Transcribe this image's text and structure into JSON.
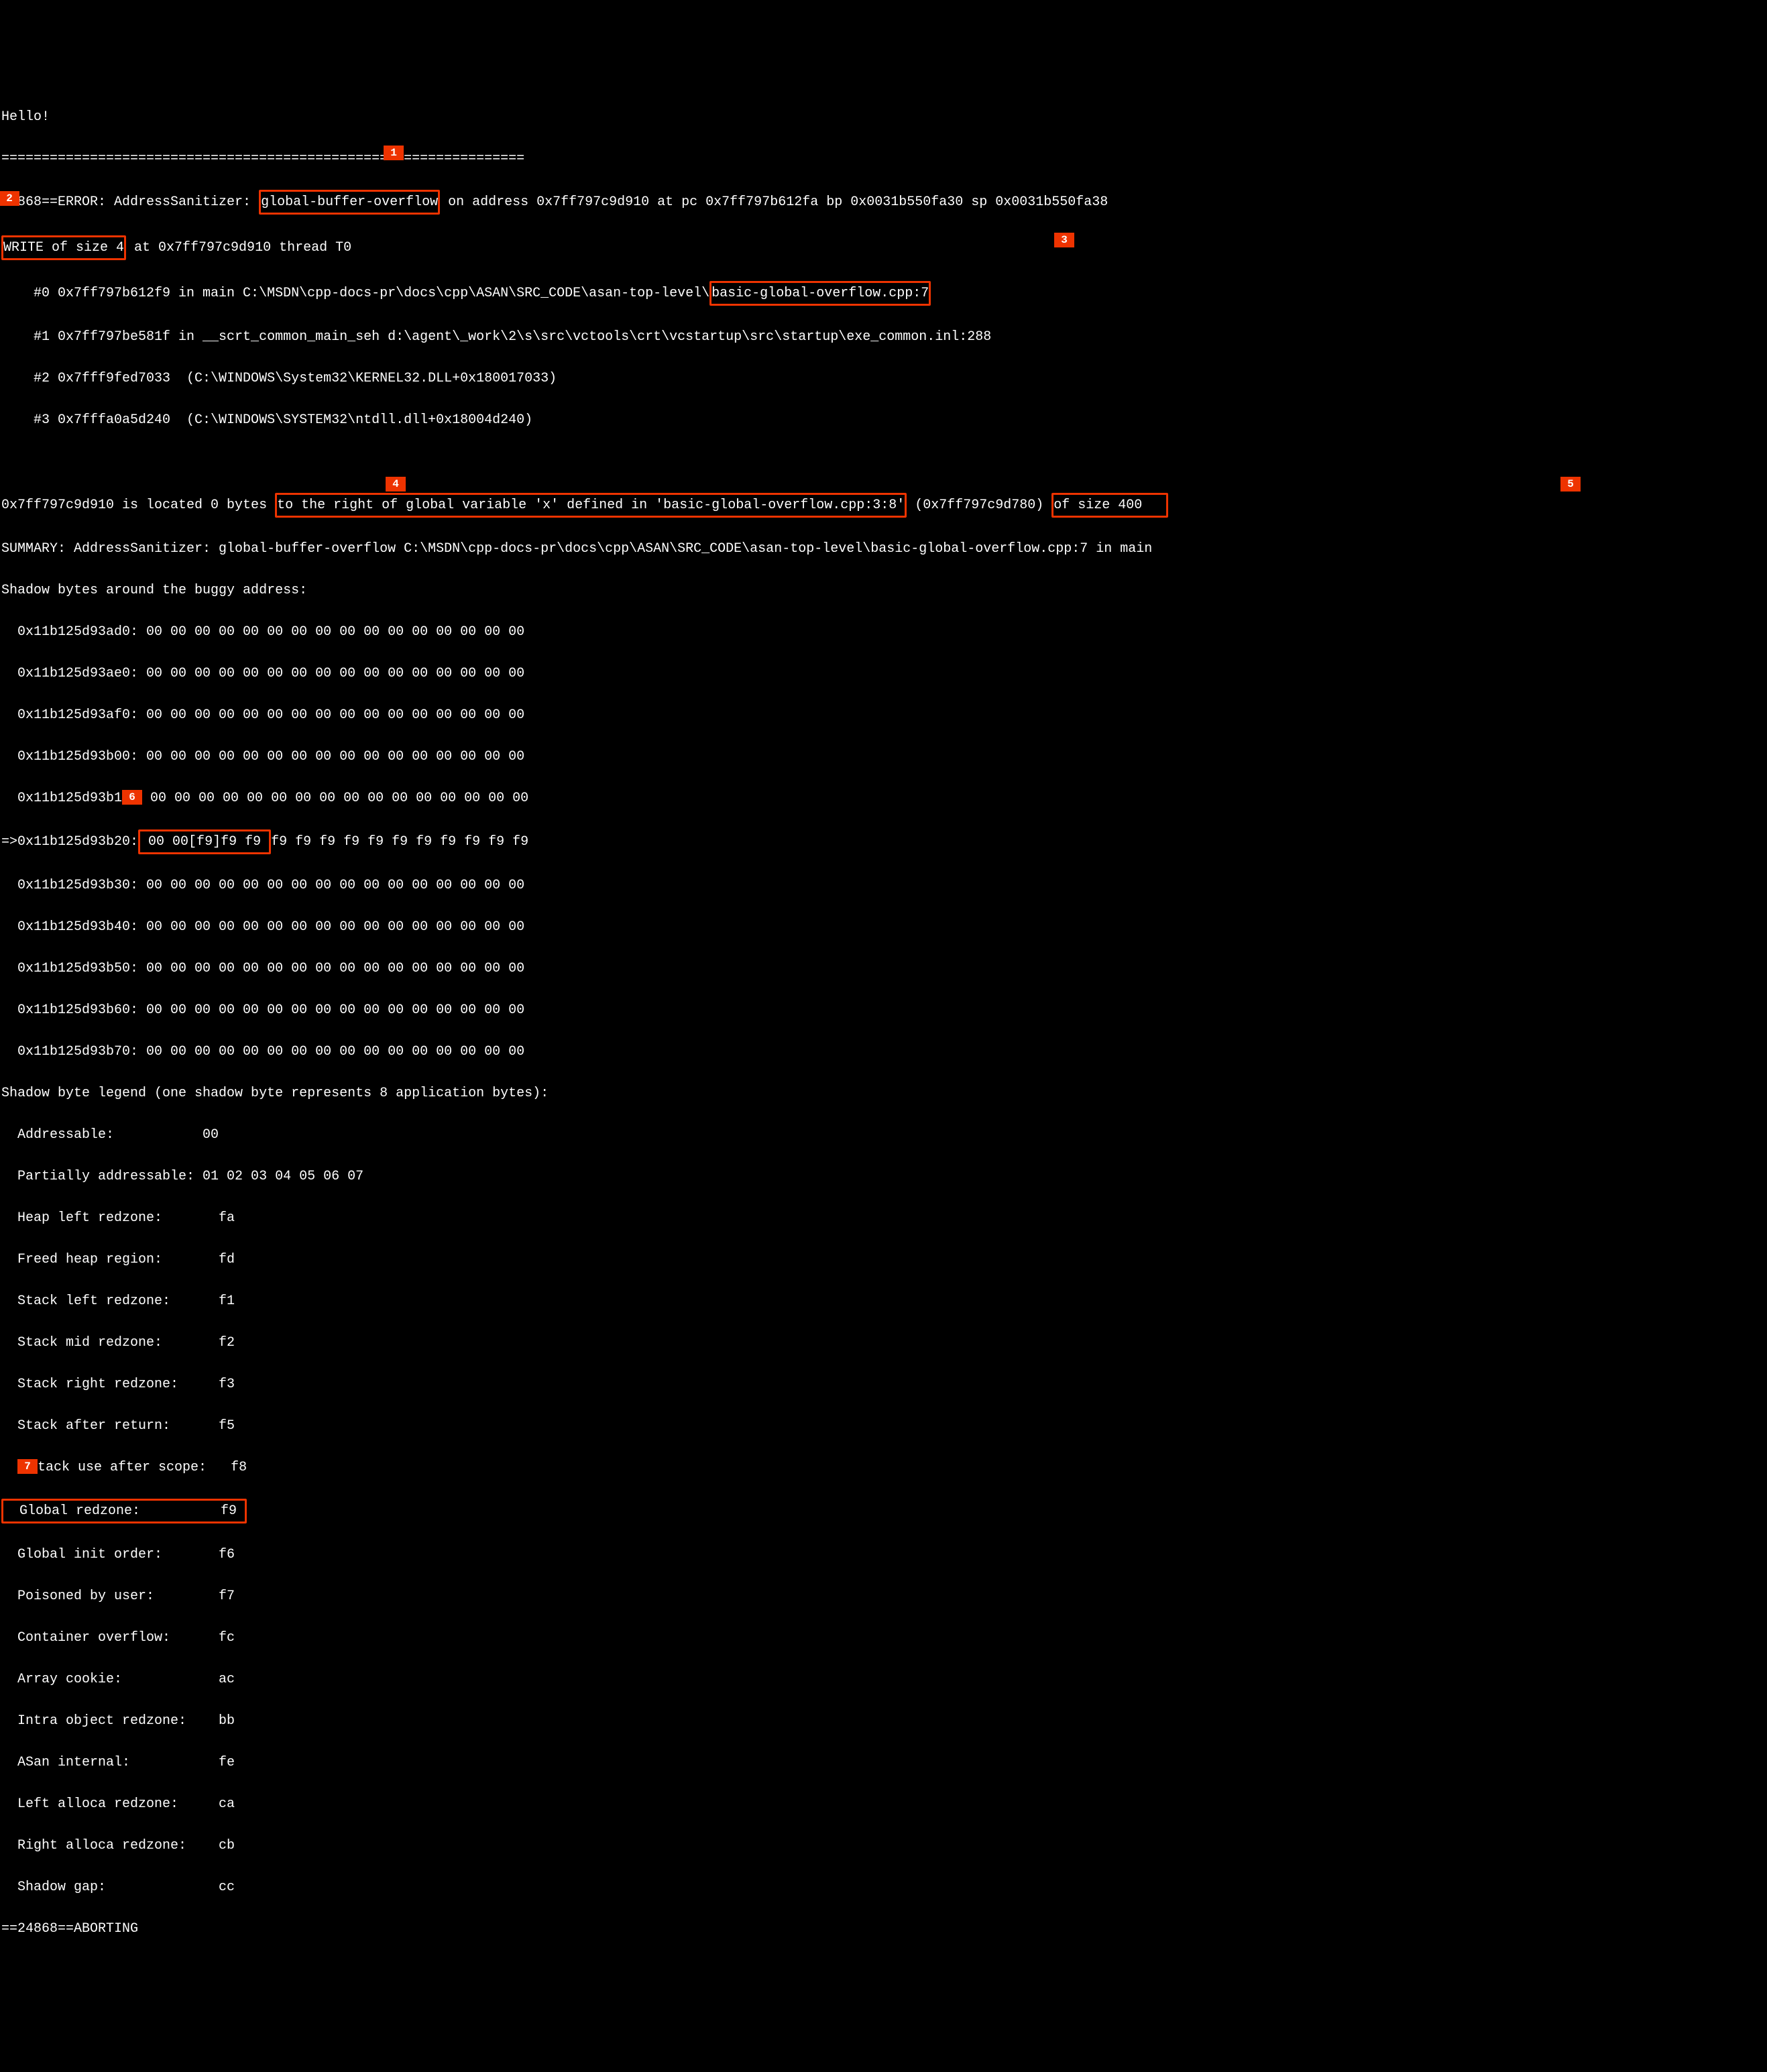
{
  "greeting": "Hello!",
  "separator": "=================================================================",
  "error": {
    "prefix_pid": "24868==ERROR: AddressSanitizer: ",
    "type": "global-buffer-overflow",
    "after_type": " on address 0x7ff797c9d910 at pc 0x7ff797b612fa bp 0x0031b550fa30 sp 0x0031b550fa38"
  },
  "write": {
    "left": "WRITE of size 4",
    "right": " at 0x7ff797c9d910 thread T0"
  },
  "stack": {
    "f0_left": "    #0 0x7ff797b612f9 in main C:\\MSDN\\cpp-docs-pr\\docs\\cpp\\ASAN\\SRC_CODE\\asan-top-level\\",
    "f0_box": "basic-global-overflow.cpp:7",
    "f1": "    #1 0x7ff797be581f in __scrt_common_main_seh d:\\agent\\_work\\2\\s\\src\\vctools\\crt\\vcstartup\\src\\startup\\exe_common.inl:288",
    "f2": "    #2 0x7fff9fed7033  (C:\\WINDOWS\\System32\\KERNEL32.DLL+0x180017033)",
    "f3": "    #3 0x7fffa0a5d240  (C:\\WINDOWS\\SYSTEM32\\ntdll.dll+0x18004d240)"
  },
  "located": {
    "left": "0x7ff797c9d910 is located 0 bytes ",
    "box4": "to the right of global variable 'x' defined in 'basic-global-overflow.cpp:3:8'",
    "mid": " (0x7ff797c9d780) ",
    "box5": "of size 400   "
  },
  "summary": "SUMMARY: AddressSanitizer: global-buffer-overflow C:\\MSDN\\cpp-docs-pr\\docs\\cpp\\ASAN\\SRC_CODE\\asan-top-level\\basic-global-overflow.cpp:7 in main",
  "shadow_header": "Shadow bytes around the buggy address:",
  "shadow": {
    "r0": "  0x11b125d93ad0: 00 00 00 00 00 00 00 00 00 00 00 00 00 00 00 00",
    "r1": "  0x11b125d93ae0: 00 00 00 00 00 00 00 00 00 00 00 00 00 00 00 00",
    "r2": "  0x11b125d93af0: 00 00 00 00 00 00 00 00 00 00 00 00 00 00 00 00",
    "r3": "  0x11b125d93b00: 00 00 00 00 00 00 00 00 00 00 00 00 00 00 00 00",
    "r4_left": "  0x11b125d93b1",
    "r4_right": " 00 00 00 00 00 00 00 00 00 00 00 00 00 00 00 00",
    "r5_left": "=>0x11b125d93b20:",
    "r5_box": " 00 00[f9]f9 f9 ",
    "r5_right": "f9 f9 f9 f9 f9 f9 f9 f9 f9 f9 f9",
    "r6": "  0x11b125d93b30: 00 00 00 00 00 00 00 00 00 00 00 00 00 00 00 00",
    "r7": "  0x11b125d93b40: 00 00 00 00 00 00 00 00 00 00 00 00 00 00 00 00",
    "r8": "  0x11b125d93b50: 00 00 00 00 00 00 00 00 00 00 00 00 00 00 00 00",
    "r9": "  0x11b125d93b60: 00 00 00 00 00 00 00 00 00 00 00 00 00 00 00 00",
    "r10": "  0x11b125d93b70: 00 00 00 00 00 00 00 00 00 00 00 00 00 00 00 00"
  },
  "legend_header": "Shadow byte legend (one shadow byte represents 8 application bytes):",
  "legend": {
    "l0": "  Addressable:           00",
    "l1": "  Partially addressable: 01 02 03 04 05 06 07",
    "l2": "  Heap left redzone:       fa",
    "l3": "  Freed heap region:       fd",
    "l4": "  Stack left redzone:      f1",
    "l5": "  Stack mid redzone:       f2",
    "l6": "  Stack right redzone:     f3",
    "l7": "  Stack after return:      f5",
    "l8_left": "  ",
    "l8_right": "tack use after scope:   f8",
    "l9": "  Global redzone:          f9 ",
    "l10": "  Global init order:       f6",
    "l11": "  Poisoned by user:        f7",
    "l12": "  Container overflow:      fc",
    "l13": "  Array cookie:            ac",
    "l14": "  Intra object redzone:    bb",
    "l15": "  ASan internal:           fe",
    "l16": "  Left alloca redzone:     ca",
    "l17": "  Right alloca redzone:    cb",
    "l18": "  Shadow gap:              cc"
  },
  "abort": "==24868==ABORTING",
  "markers": {
    "m1": "1",
    "m2": "2",
    "m3": "3",
    "m4": "4",
    "m5": "5",
    "m6": "6",
    "m7": "7"
  }
}
